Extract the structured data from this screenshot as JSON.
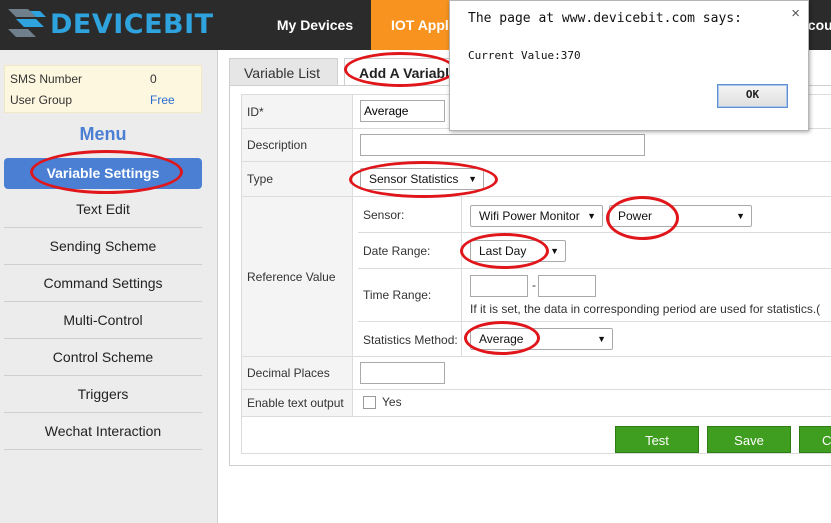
{
  "header": {
    "logo_text": "DEVICEBIT",
    "nav": {
      "my_devices": "My Devices",
      "iot_app": "IOT Appli",
      "account": "ccoun"
    },
    "colors": {
      "bar": "#2b2b2b",
      "active_nav": "#f7931e",
      "logo": "#2ea3dd"
    }
  },
  "sidebar": {
    "info": {
      "sms_label": "SMS Number",
      "sms_value": "0",
      "group_label": "User Group",
      "group_value": "Free"
    },
    "menu_title": "Menu",
    "items": [
      {
        "label": "Variable Settings",
        "active": true
      },
      {
        "label": "Text Edit"
      },
      {
        "label": "Sending Scheme"
      },
      {
        "label": "Command Settings"
      },
      {
        "label": "Multi-Control"
      },
      {
        "label": "Control Scheme"
      },
      {
        "label": "Triggers"
      },
      {
        "label": "Wechat Interaction"
      }
    ]
  },
  "tabs": {
    "list": "Variable List",
    "add": "Add A Variabl"
  },
  "form": {
    "id": {
      "label": "ID*",
      "value": "Average"
    },
    "description": {
      "label": "Description",
      "value": ""
    },
    "type": {
      "label": "Type",
      "value": "Sensor Statistics"
    },
    "reference": {
      "label": "Reference Value",
      "sensor": {
        "label": "Sensor:",
        "device": "Wifi Power Monitor",
        "channel": "Power"
      },
      "date_range": {
        "label": "Date Range:",
        "value": "Last Day"
      },
      "time_range": {
        "label": "Time Range:",
        "separator": "-",
        "start": "",
        "end": "",
        "note": "If it is set, the data in corresponding period are used for statistics.("
      },
      "method": {
        "label": "Statistics Method:",
        "value": "Average"
      }
    },
    "decimal": {
      "label": "Decimal Places",
      "value": ""
    },
    "text_output": {
      "label": "Enable text output",
      "option": "Yes",
      "checked": false
    }
  },
  "buttons": {
    "test": "Test",
    "save": "Save",
    "cancel": "C"
  },
  "alert": {
    "title": "The page at www.devicebit.com says:",
    "message": "Current Value:370",
    "ok": "OK",
    "close": "×"
  },
  "annotation_color": "#e0161b"
}
